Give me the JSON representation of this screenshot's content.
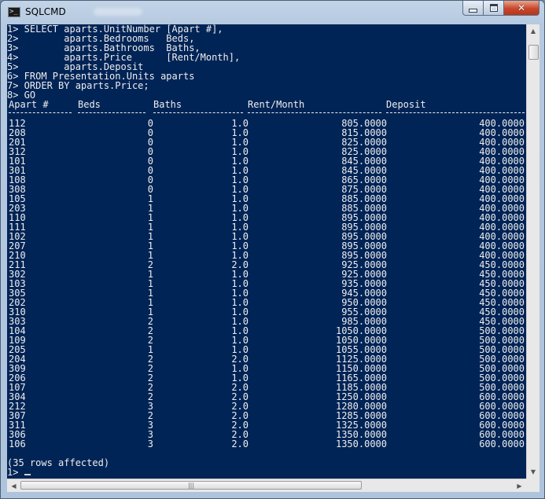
{
  "window": {
    "title": "SQLCMD",
    "icon": "console-icon",
    "controls": {
      "minimize": "minimize-icon",
      "maximize": "maximize-icon",
      "close": "close-icon"
    }
  },
  "console": {
    "query_lines": [
      "1> SELECT aparts.UnitNumber [Apart #],",
      "2>        aparts.Bedrooms   Beds,",
      "3>        aparts.Bathrooms  Baths,",
      "4>        aparts.Price      [Rent/Month],",
      "5>        aparts.Deposit",
      "6> FROM Presentation.Units aparts",
      "7> ORDER BY aparts.Price;",
      "8> GO"
    ],
    "columns": [
      "Apart #",
      "Beds",
      "Baths",
      "Rent/Month",
      "Deposit"
    ],
    "rows": [
      [
        "112",
        "0",
        "1.0",
        "805.0000",
        "400.0000"
      ],
      [
        "208",
        "0",
        "1.0",
        "815.0000",
        "400.0000"
      ],
      [
        "201",
        "0",
        "1.0",
        "825.0000",
        "400.0000"
      ],
      [
        "312",
        "0",
        "1.0",
        "825.0000",
        "400.0000"
      ],
      [
        "101",
        "0",
        "1.0",
        "845.0000",
        "400.0000"
      ],
      [
        "301",
        "0",
        "1.0",
        "845.0000",
        "400.0000"
      ],
      [
        "108",
        "0",
        "1.0",
        "865.0000",
        "400.0000"
      ],
      [
        "308",
        "0",
        "1.0",
        "875.0000",
        "400.0000"
      ],
      [
        "105",
        "1",
        "1.0",
        "885.0000",
        "400.0000"
      ],
      [
        "203",
        "1",
        "1.0",
        "885.0000",
        "400.0000"
      ],
      [
        "110",
        "1",
        "1.0",
        "895.0000",
        "400.0000"
      ],
      [
        "111",
        "1",
        "1.0",
        "895.0000",
        "400.0000"
      ],
      [
        "102",
        "1",
        "1.0",
        "895.0000",
        "400.0000"
      ],
      [
        "207",
        "1",
        "1.0",
        "895.0000",
        "400.0000"
      ],
      [
        "210",
        "1",
        "1.0",
        "895.0000",
        "400.0000"
      ],
      [
        "211",
        "2",
        "2.0",
        "925.0000",
        "450.0000"
      ],
      [
        "302",
        "1",
        "1.0",
        "925.0000",
        "450.0000"
      ],
      [
        "103",
        "1",
        "1.0",
        "935.0000",
        "450.0000"
      ],
      [
        "305",
        "1",
        "1.0",
        "945.0000",
        "450.0000"
      ],
      [
        "202",
        "1",
        "1.0",
        "950.0000",
        "450.0000"
      ],
      [
        "310",
        "1",
        "1.0",
        "955.0000",
        "450.0000"
      ],
      [
        "303",
        "2",
        "1.0",
        "985.0000",
        "450.0000"
      ],
      [
        "104",
        "2",
        "1.0",
        "1050.0000",
        "500.0000"
      ],
      [
        "109",
        "2",
        "1.0",
        "1050.0000",
        "500.0000"
      ],
      [
        "205",
        "1",
        "1.0",
        "1055.0000",
        "500.0000"
      ],
      [
        "204",
        "2",
        "2.0",
        "1125.0000",
        "500.0000"
      ],
      [
        "309",
        "2",
        "1.0",
        "1150.0000",
        "500.0000"
      ],
      [
        "206",
        "2",
        "1.0",
        "1165.0000",
        "500.0000"
      ],
      [
        "107",
        "2",
        "2.0",
        "1185.0000",
        "500.0000"
      ],
      [
        "304",
        "2",
        "2.0",
        "1250.0000",
        "600.0000"
      ],
      [
        "212",
        "3",
        "2.0",
        "1280.0000",
        "600.0000"
      ],
      [
        "307",
        "2",
        "2.0",
        "1285.0000",
        "600.0000"
      ],
      [
        "311",
        "3",
        "2.0",
        "1325.0000",
        "600.0000"
      ],
      [
        "306",
        "3",
        "2.0",
        "1350.0000",
        "600.0000"
      ],
      [
        "106",
        "3",
        "2.0",
        "1350.0000",
        "600.0000"
      ]
    ],
    "rows_affected": "(35 rows affected)",
    "prompt": "1>"
  },
  "colors": {
    "console_background": "#012456",
    "console_text": "#eeeeee"
  }
}
